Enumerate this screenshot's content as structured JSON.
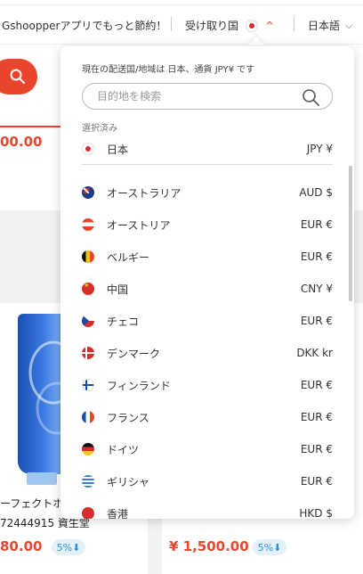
{
  "header": {
    "promo_text": "Gshoopperアプリでもっと節約！",
    "ship_to_label": "受け取り国",
    "ship_to_chevron": "^",
    "language": "日本語",
    "language_chevron": "⌵"
  },
  "background": {
    "price_top": "00.00",
    "product_name_1": "ーフェクトホ",
    "product_name_2": "72444915 資生堂",
    "price_left": "80.00",
    "discount_left": "5%⬇",
    "price_right": "¥ 1,500.00",
    "discount_right": "5%⬇"
  },
  "panel": {
    "info": "現在の配送国/地域は 日本、通貨 JPY¥ です",
    "search_placeholder": "目的地を検索",
    "selected_label": "選択済み",
    "selected": {
      "name": "日本",
      "currency": "JPY ¥",
      "flag": "jp"
    },
    "countries": [
      {
        "name": "オーストラリア",
        "currency": "AUD $",
        "flag": "au"
      },
      {
        "name": "オーストリア",
        "currency": "EUR €",
        "flag": "at"
      },
      {
        "name": "ベルギー",
        "currency": "EUR €",
        "flag": "be"
      },
      {
        "name": "中国",
        "currency": "CNY ¥",
        "flag": "cn"
      },
      {
        "name": "チェコ",
        "currency": "EUR €",
        "flag": "cz"
      },
      {
        "name": "デンマーク",
        "currency": "DKK kr",
        "flag": "dk"
      },
      {
        "name": "フィンランド",
        "currency": "EUR €",
        "flag": "fi"
      },
      {
        "name": "フランス",
        "currency": "EUR €",
        "flag": "fr"
      },
      {
        "name": "ドイツ",
        "currency": "EUR €",
        "flag": "de"
      },
      {
        "name": "ギリシャ",
        "currency": "EUR €",
        "flag": "gr"
      },
      {
        "name": "香港",
        "currency": "HKD $",
        "flag": "hk"
      }
    ]
  },
  "colors": {
    "accent": "#e8452c",
    "badge_text": "#2c8fd6",
    "badge_bg": "#e4f1fb"
  }
}
